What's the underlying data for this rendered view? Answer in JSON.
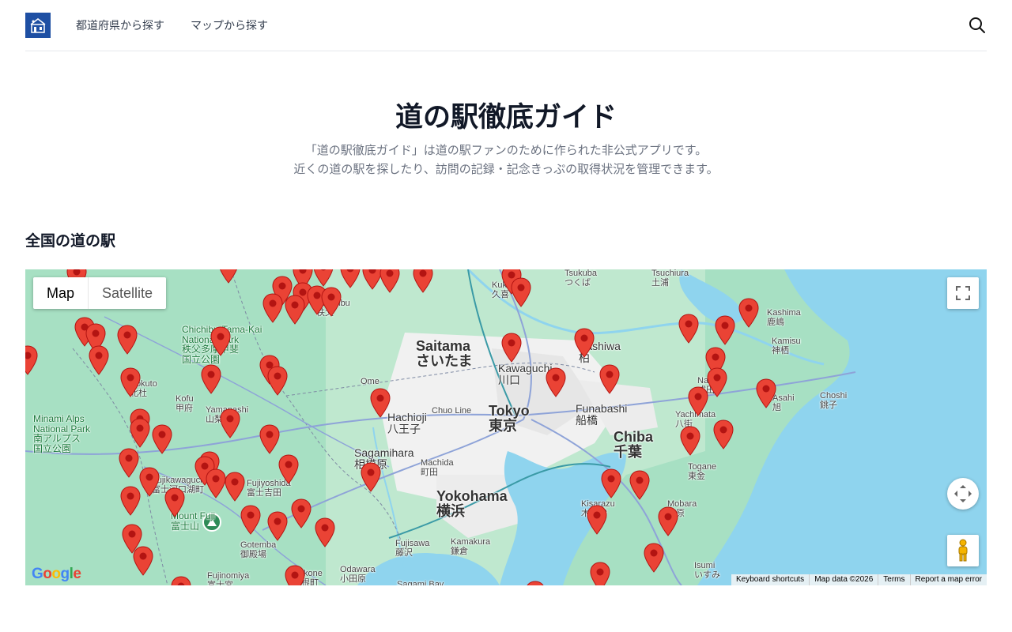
{
  "nav": {
    "links": [
      "都道府県から探す",
      "マップから探す"
    ]
  },
  "hero": {
    "title": "道の駅徹底ガイド",
    "description_line1": "「道の駅徹底ガイド」は道の駅ファンのために作られた非公式アプリです。",
    "description_line2": "近くの道の駅を探したり、訪問の記録・記念きっぷの取得状況を管理できます。"
  },
  "section": {
    "title": "全国の道の駅"
  },
  "map": {
    "type_buttons": [
      "Map",
      "Satellite"
    ],
    "selected_type": "Map",
    "attribution": [
      "Keyboard shortcuts",
      "Map data ©2026",
      "Terms",
      "Report a map error"
    ],
    "google_logo": "Google",
    "colors": {
      "water": "#8fd4ee",
      "land": "#a7e0c3",
      "urban": "#f2f2f2",
      "marker": "#ea4335"
    },
    "labels": [
      {
        "text": "Saitama\nさいたま",
        "size": "lbl-big"
      },
      {
        "text": "Tokyo\n東京",
        "size": "lbl-big"
      },
      {
        "text": "Chiba\n千葉",
        "size": "lbl-big"
      },
      {
        "text": "Yokohama\n横浜",
        "size": "lbl-big"
      },
      {
        "text": "Sagamihara\n相模原",
        "size": "lbl-med"
      },
      {
        "text": "Hachioji\n八王子",
        "size": "lbl-med"
      },
      {
        "text": "Funabashi\n船橋",
        "size": "lbl-med"
      },
      {
        "text": "Kawaguchi\n川口",
        "size": "lbl-med"
      },
      {
        "text": "Kashiwa\n柏",
        "size": "lbl-med"
      },
      {
        "text": "Chichibu-Tama-Kai\nNational Park\n秩父多摩甲斐\n国立公園",
        "size": "lbl-park"
      },
      {
        "text": "Minami Alps\nNational Park\n南アルプス\n国立公園",
        "size": "lbl-park"
      },
      {
        "text": "Mount Fuji\n富士山",
        "size": "lbl-park"
      },
      {
        "text": "Kofu\n甲府",
        "size": "lbl-sm"
      },
      {
        "text": "Hokuto\n北杜",
        "size": "lbl-sm"
      },
      {
        "text": "Yamanashi\n山梨",
        "size": "lbl-sm"
      },
      {
        "text": "Fujiyoshida\n富士吉田",
        "size": "lbl-sm"
      },
      {
        "text": "Fujikawaguchiko\n富士河口湖町",
        "size": "lbl-sm"
      },
      {
        "text": "Gotemba\n御殿場",
        "size": "lbl-sm"
      },
      {
        "text": "Odawara\n小田原",
        "size": "lbl-sm"
      },
      {
        "text": "Fujisawa\n藤沢",
        "size": "lbl-sm"
      },
      {
        "text": "Kamakura\n鎌倉",
        "size": "lbl-sm"
      },
      {
        "text": "Machida\n町田",
        "size": "lbl-sm"
      },
      {
        "text": "Kisarazu\n木更津",
        "size": "lbl-sm"
      },
      {
        "text": "Mobara\n茂原",
        "size": "lbl-sm"
      },
      {
        "text": "Togane\n東金",
        "size": "lbl-sm"
      },
      {
        "text": "Isumi\nいすみ",
        "size": "lbl-sm"
      },
      {
        "text": "Yachimata\n八街",
        "size": "lbl-sm"
      },
      {
        "text": "Narita\n成田",
        "size": "lbl-sm"
      },
      {
        "text": "Asahi\n旭",
        "size": "lbl-sm"
      },
      {
        "text": "Choshi\n銚子",
        "size": "lbl-sm"
      },
      {
        "text": "Kashima\n鹿嶋",
        "size": "lbl-sm"
      },
      {
        "text": "Kamisu\n神栖",
        "size": "lbl-sm"
      },
      {
        "text": "Tsukuba\nつくば",
        "size": "lbl-sm"
      },
      {
        "text": "Tsuchiura\n土浦",
        "size": "lbl-sm"
      },
      {
        "text": "Kuki\n久喜",
        "size": "lbl-sm"
      },
      {
        "text": "Chichibu\n秩父",
        "size": "lbl-sm"
      },
      {
        "text": "Fujinomiya\n富士宮",
        "size": "lbl-sm"
      },
      {
        "text": "Hakone\n箱根町",
        "size": "lbl-sm"
      },
      {
        "text": "Ome",
        "size": "lbl-sm"
      },
      {
        "text": "Chuo Line",
        "size": "lbl-sm"
      },
      {
        "text": "Sagami Bay",
        "size": "lbl-sm"
      }
    ]
  }
}
